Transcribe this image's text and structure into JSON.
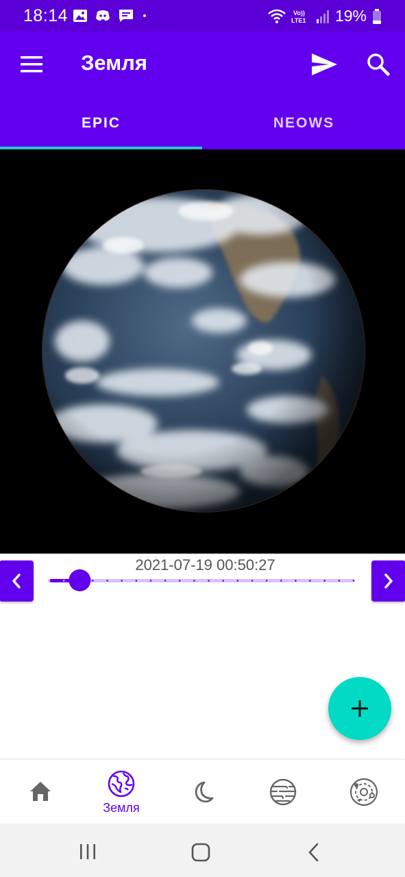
{
  "status_bar": {
    "time": "18:14",
    "battery": "19%",
    "icons": [
      "gallery-icon",
      "discord-icon",
      "message-icon",
      "dot-icon",
      "wifi-icon",
      "volte-icon",
      "signal-icon",
      "battery-icon"
    ]
  },
  "app_bar": {
    "title": "Земля",
    "icons": [
      "menu-icon",
      "send-icon",
      "search-icon"
    ]
  },
  "tabs": [
    {
      "label": "EPIC",
      "selected": true
    },
    {
      "label": "NEOWS",
      "selected": false
    }
  ],
  "viewer": {
    "date": "2021-07-19 00:50:27",
    "slider_position": 0.1,
    "slider_steps": 21
  },
  "fab": {
    "icon": "plus-icon"
  },
  "bottom_nav": {
    "items": [
      {
        "icon": "home-icon",
        "label": ""
      },
      {
        "icon": "globe-icon",
        "label": "Земля",
        "selected": true
      },
      {
        "icon": "moon-icon",
        "label": ""
      },
      {
        "icon": "planet-icon",
        "label": ""
      },
      {
        "icon": "solar-system-icon",
        "label": ""
      }
    ]
  },
  "colors": {
    "primary": "#6200ee",
    "status_bar": "#5a00d6",
    "accent": "#03dac5",
    "tab_indicator": "#26c6da"
  }
}
